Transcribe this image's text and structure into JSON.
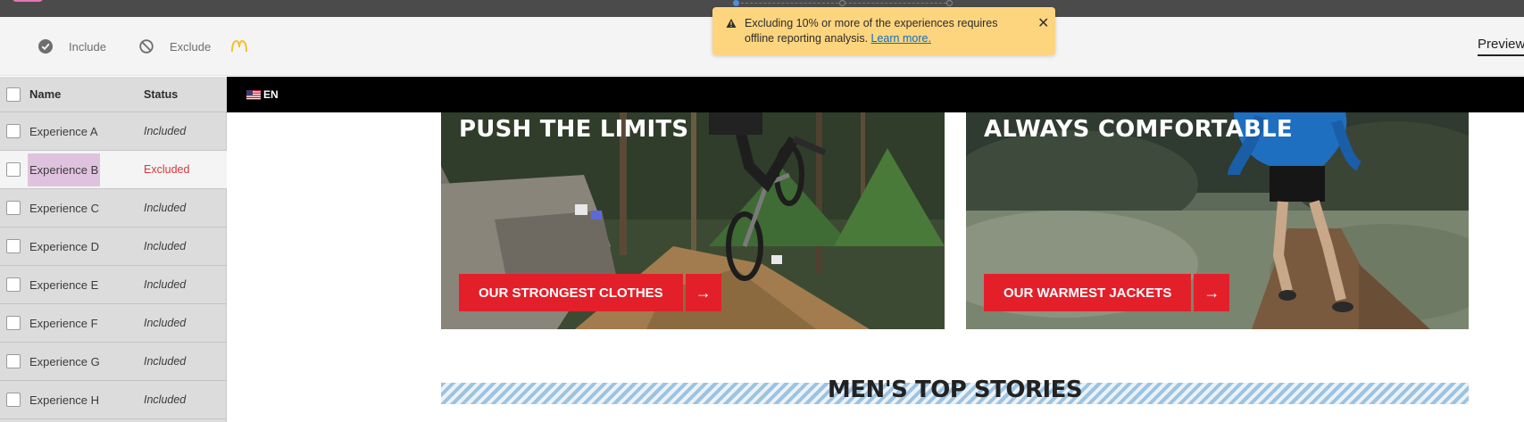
{
  "toolbar": {
    "include_label": "Include",
    "exclude_label": "Exclude",
    "preview_label": "Preview"
  },
  "toast": {
    "message": "Excluding 10% or more of the experiences requires offline reporting analysis.",
    "link": "Learn more."
  },
  "table": {
    "headers": {
      "name": "Name",
      "status": "Status"
    },
    "rows": [
      {
        "name": "Experience A",
        "status": "Included"
      },
      {
        "name": "Experience B",
        "status": "Excluded"
      },
      {
        "name": "Experience C",
        "status": "Included"
      },
      {
        "name": "Experience D",
        "status": "Included"
      },
      {
        "name": "Experience E",
        "status": "Included"
      },
      {
        "name": "Experience F",
        "status": "Included"
      },
      {
        "name": "Experience G",
        "status": "Included"
      },
      {
        "name": "Experience H",
        "status": "Included"
      }
    ]
  },
  "page": {
    "language": "EN",
    "heroes": [
      {
        "title": "PUSH THE LIMITS",
        "cta": "OUR STRONGEST CLOTHES"
      },
      {
        "title": "ALWAYS COMFORTABLE",
        "cta": "OUR WARMEST JACKETS"
      }
    ],
    "section_title": "MEN'S TOP STORIES"
  },
  "colors": {
    "accent_red": "#e3202a",
    "excluded_red": "#d7373f",
    "toast_bg": "#fdd57e",
    "highlight": "#dfc3de"
  }
}
